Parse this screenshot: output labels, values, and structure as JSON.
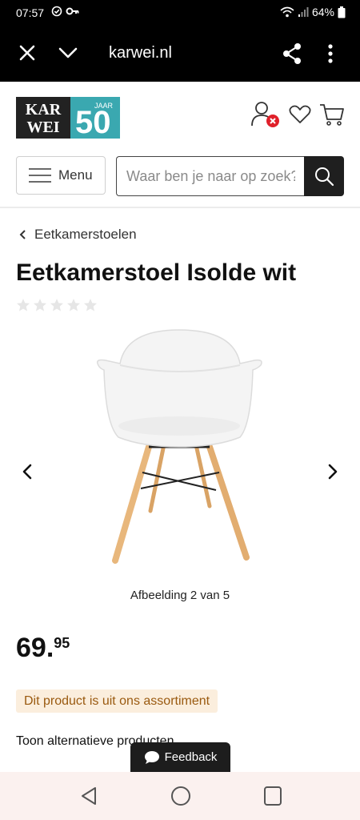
{
  "status_bar": {
    "time": "07:57",
    "battery": "64%"
  },
  "browser": {
    "url": "karwei.nl",
    "icons": [
      "close-icon",
      "chevron-down-icon",
      "share-icon",
      "more-vert-icon"
    ]
  },
  "header": {
    "logo": {
      "brand_line1": "KAR",
      "brand_line2": "WEI",
      "anniversary_label": "JAAR",
      "anniversary_number": "50",
      "colors": {
        "brand_black": "#222222",
        "brand_teal": "#3aa8b0"
      }
    },
    "menu_label": "Menu",
    "search_placeholder": "Waar ben je naar op zoek?"
  },
  "breadcrumb": {
    "label": "Eetkamerstoelen"
  },
  "product": {
    "title": "Eetkamerstoel Isolde wit",
    "rating_stars": 5,
    "rating_value": 0,
    "image_caption": "Afbeelding 2 van 5",
    "price_main": "69.",
    "price_cents": "95",
    "notice": "Dit product is uit ons assortiment",
    "alternatives_link": "Toon alternatieve producten"
  },
  "feedback": {
    "label": "Feedback"
  },
  "colors": {
    "notice_bg": "#fbeedd",
    "notice_text": "#9a5a10",
    "alert_red": "#e0202a"
  }
}
